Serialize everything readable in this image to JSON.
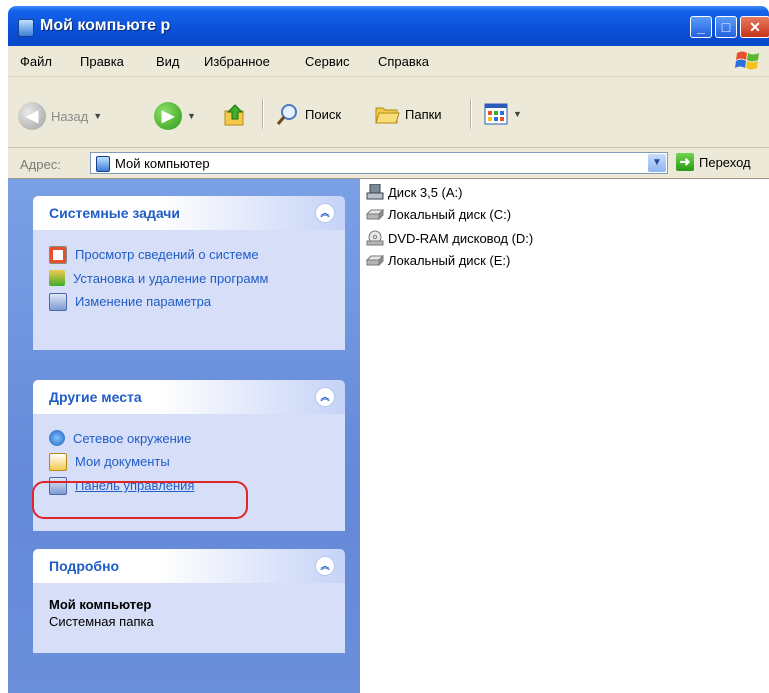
{
  "window": {
    "title": "Мой компьюте р"
  },
  "menu": [
    {
      "label": "Файл"
    },
    {
      "label": "Правка"
    },
    {
      "label": "Вид"
    },
    {
      "label": "Избранное"
    },
    {
      "label": "Сервис"
    },
    {
      "label": "Справка"
    }
  ],
  "toolbar": {
    "back_label": "Назад",
    "search_label": "Поиск",
    "folders_label": "Папки"
  },
  "address": {
    "label": "Адрес:",
    "value": "Мой компьютер",
    "go_label": "Переход"
  },
  "panels": {
    "system": {
      "title": "Системные задачи",
      "items": [
        {
          "label": "Просмотр сведений о системе"
        },
        {
          "label": "Установка и удаление программ"
        },
        {
          "label": "Изменение параметра"
        }
      ]
    },
    "places": {
      "title": "Другие места",
      "items": [
        {
          "label": "Сетевое окружение"
        },
        {
          "label": "Мои документы"
        },
        {
          "label": "Панель управления"
        }
      ]
    },
    "details": {
      "title": "Подробно",
      "name": "Мой компьютер",
      "desc": "Системная папка"
    }
  },
  "drives": [
    {
      "label": "Диск 3,5 (A:)",
      "icon": "floppy-drive-icon"
    },
    {
      "label": "Локальный диск (C:)",
      "icon": "hard-disk-icon"
    },
    {
      "label": "DVD-RAM дисковод (D:)",
      "icon": "dvd-drive-icon"
    },
    {
      "label": "Локальный диск (E:)",
      "icon": "hard-disk-icon"
    }
  ],
  "colors": {
    "title_bar": "#0a50d8",
    "task_pane": "#6b8fdc",
    "link": "#215dc6",
    "highlight": "#e0262a"
  }
}
